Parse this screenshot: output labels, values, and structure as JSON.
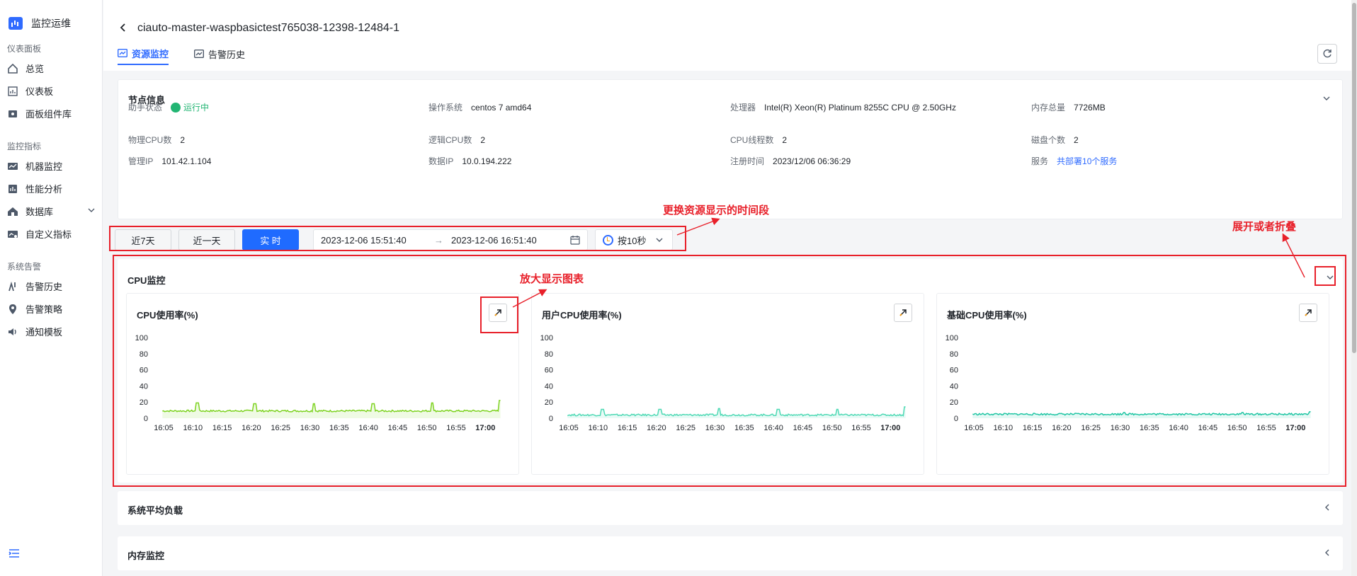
{
  "sidebar": {
    "brand": "监控运维",
    "groups": [
      {
        "title": "仪表面板",
        "items": [
          {
            "label": "总览",
            "icon": "home-icon"
          },
          {
            "label": "仪表板",
            "icon": "dashboard-icon"
          },
          {
            "label": "面板组件库",
            "icon": "widget-library-icon"
          }
        ]
      },
      {
        "title": "监控指标",
        "items": [
          {
            "label": "机器监控",
            "icon": "machine-icon"
          },
          {
            "label": "性能分析",
            "icon": "performance-icon"
          },
          {
            "label": "数据库",
            "icon": "database-icon"
          },
          {
            "label": "自定义指标",
            "icon": "custom-metric-icon"
          }
        ]
      },
      {
        "title": "系统告警",
        "items": [
          {
            "label": "告警历史",
            "icon": "alert-history-icon"
          },
          {
            "label": "告警策略",
            "icon": "alert-policy-icon"
          },
          {
            "label": "通知模板",
            "icon": "notify-template-icon"
          }
        ]
      }
    ]
  },
  "header": {
    "title": "ciauto-master-waspbasictest765038-12398-12484-1",
    "tabs": [
      {
        "label": "资源监控",
        "active": true
      },
      {
        "label": "告警历史",
        "active": false
      }
    ]
  },
  "node_info": {
    "title": "节点信息",
    "fields": {
      "agent_status_label": "助手状态",
      "agent_status_value": "运行中",
      "os_label": "操作系统",
      "os_value": "centos 7 amd64",
      "cpu_label": "处理器",
      "cpu_value": "Intel(R) Xeon(R) Platinum 8255C CPU @ 2.50GHz",
      "mem_label": "内存总量",
      "mem_value": "7726MB",
      "phys_cpu_label": "物理CPU数",
      "phys_cpu_value": "2",
      "logic_cpu_label": "逻辑CPU数",
      "logic_cpu_value": "2",
      "threads_label": "CPU线程数",
      "threads_value": "2",
      "disks_label": "磁盘个数",
      "disks_value": "2",
      "mgmt_ip_label": "管理IP",
      "mgmt_ip_value": "101.42.1.104",
      "data_ip_label": "数据IP",
      "data_ip_value": "10.0.194.222",
      "reg_time_label": "注册时间",
      "reg_time_value": "2023/12/06 06:36:29",
      "service_label": "服务",
      "service_value": "共部署10个服务"
    }
  },
  "time_toolbar": {
    "btn_7d": "近7天",
    "btn_1d": "近一天",
    "btn_realtime": "实 时",
    "start": "2023-12-06 15:51:40",
    "arrow": "→",
    "end": "2023-12-06 16:51:40",
    "interval": "按10秒"
  },
  "cpu_panel": {
    "title": "CPU监控"
  },
  "collapsed_panels": [
    "系统平均负载",
    "内存监控"
  ],
  "annotations": {
    "time_range": "更换资源显示的时间段",
    "zoom": "放大显示图表",
    "collapse": "展开或者折叠"
  },
  "colors": {
    "accent": "#2f6bff",
    "running": "#22b573",
    "annotation_red": "#e8202a"
  },
  "chart_data": [
    {
      "type": "line",
      "title": "CPU使用率(%)",
      "color": "#7ed321",
      "ylim": [
        0,
        100
      ],
      "yticks": [
        "100",
        "80",
        "60",
        "40",
        "20",
        "0"
      ],
      "xticks": [
        "16:05",
        "16:10",
        "16:15",
        "16:20",
        "16:25",
        "16:30",
        "16:35",
        "16:40",
        "16:45",
        "16:50",
        "16:55",
        "17:00"
      ],
      "baseline": 9,
      "spikes": [
        [
          16.25,
          19
        ],
        [
          16.58,
          18
        ],
        [
          16.92,
          18
        ],
        [
          17.26,
          18
        ],
        [
          17.6,
          19
        ],
        [
          17.99,
          22
        ]
      ]
    },
    {
      "type": "line",
      "title": "用户CPU使用率(%)",
      "color": "#4dd9b4",
      "ylim": [
        0,
        100
      ],
      "yticks": [
        "100",
        "80",
        "60",
        "40",
        "20",
        "0"
      ],
      "xticks": [
        "16:05",
        "16:10",
        "16:15",
        "16:20",
        "16:25",
        "16:30",
        "16:35",
        "16:40",
        "16:45",
        "16:50",
        "16:55",
        "17:00"
      ],
      "baseline": 4,
      "spikes": [
        [
          16.25,
          11
        ],
        [
          16.58,
          11
        ],
        [
          16.92,
          12
        ],
        [
          17.26,
          11
        ],
        [
          17.6,
          11
        ],
        [
          17.99,
          14
        ]
      ]
    },
    {
      "type": "line",
      "title": "基础CPU使用率(%)",
      "color": "#1ec5a3",
      "ylim": [
        0,
        100
      ],
      "yticks": [
        "100",
        "80",
        "60",
        "40",
        "20",
        "0"
      ],
      "xticks": [
        "16:05",
        "16:10",
        "16:15",
        "16:20",
        "16:25",
        "16:30",
        "16:35",
        "16:40",
        "16:45",
        "16:50",
        "16:55",
        "17:00"
      ],
      "baseline": 5,
      "spikes": [
        [
          16.92,
          7
        ],
        [
          17.6,
          7
        ],
        [
          17.99,
          8
        ]
      ]
    }
  ]
}
